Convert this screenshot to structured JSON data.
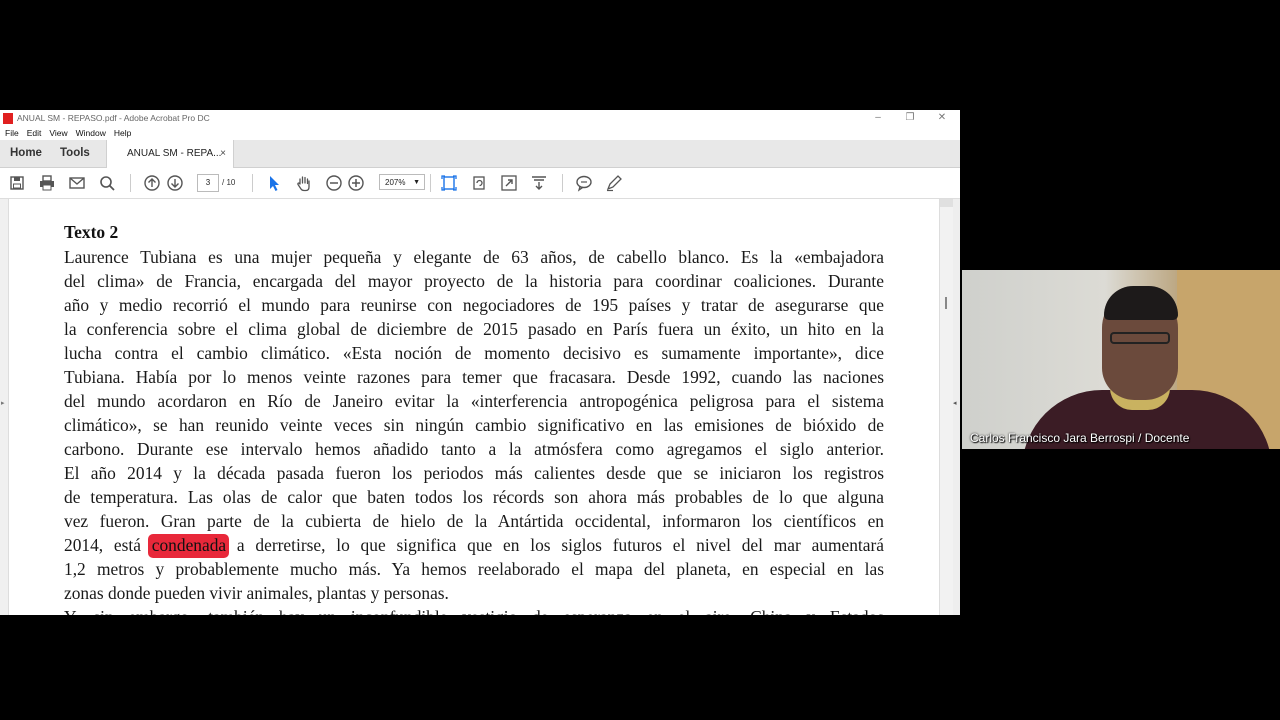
{
  "window": {
    "title": "ANUAL SM - REPASO.pdf - Adobe Acrobat Pro DC",
    "controls": {
      "minimize": "–",
      "restore": "❐",
      "close": "✕"
    }
  },
  "menu": [
    "File",
    "Edit",
    "View",
    "Window",
    "Help"
  ],
  "tabs": {
    "home": "Home",
    "tools": "Tools",
    "document": "ANUAL SM - REPA...",
    "close": "×"
  },
  "toolbar": {
    "icons": [
      "save-icon",
      "print-icon",
      "email-icon",
      "search-icon",
      "page-up-icon",
      "page-down-icon",
      "select-cursor-icon",
      "hand-icon",
      "zoom-out-icon",
      "zoom-in-icon",
      "fit-page-icon",
      "rotate-icon",
      "fullscreen-icon",
      "extract-icon",
      "comment-icon",
      "highlight-pen-icon"
    ],
    "page_current": "3",
    "page_total": "/ 10",
    "zoom": "207%"
  },
  "document": {
    "heading": "Texto 2",
    "lines": [
      "Laurence Tubiana es una mujer pequeña y elegante de 63 años, de cabello blanco. Es la «embajadora",
      "del clima» de Francia, encargada del mayor proyecto de la historia para coordinar coaliciones. Durante",
      "año y medio recorrió el mundo para reunirse con negociadores de 195 países y tratar de asegurarse que",
      "la conferencia sobre el clima global de diciembre de 2015 pasado en París fuera un éxito, un hito en la",
      "lucha contra el cambio climático. «Esta noción de momento decisivo es sumamente importante», dice",
      "Tubiana. Había por lo menos veinte razones para temer que fracasara. Desde 1992, cuando las naciones",
      "del mundo acordaron en Río de Janeiro evitar la «interferencia antropogénica peligrosa para el sistema",
      "climático», se han reunido veinte veces sin ningún cambio significativo en las emisiones de bióxido de",
      "carbono. Durante ese intervalo hemos añadido tanto a la atmósfera como agregamos el siglo anterior.",
      "El año 2014 y la década pasada fueron los periodos más calientes desde que se iniciaron los registros",
      "de temperatura. Las olas de calor que baten todos los récords son ahora más probables de lo que alguna",
      "vez fueron. Gran parte de la cubierta de hielo de la Antártida occidental, informaron los científicos en"
    ],
    "line13_before": "2014, está ",
    "line13_highlight": "condenada",
    "line13_after": " a derretirse, lo que significa que en los siglos futuros el nivel del mar aumentará",
    "line14": "1,2 metros y probablemente mucho más. Ya hemos reelaborado el mapa del planeta, en especial en las",
    "line15": "zonas donde pueden vivir animales, plantas y personas.",
    "line16": "Y, sin embargo, también hay un inconfundible vestigio de esperanza en el aire. China y Estados"
  },
  "webcam": {
    "caption": "Carlos Francisco Jara Berrospi / Docente"
  },
  "colors": {
    "highlight": "#e8283a",
    "accent_blue": "#1a73e8"
  }
}
